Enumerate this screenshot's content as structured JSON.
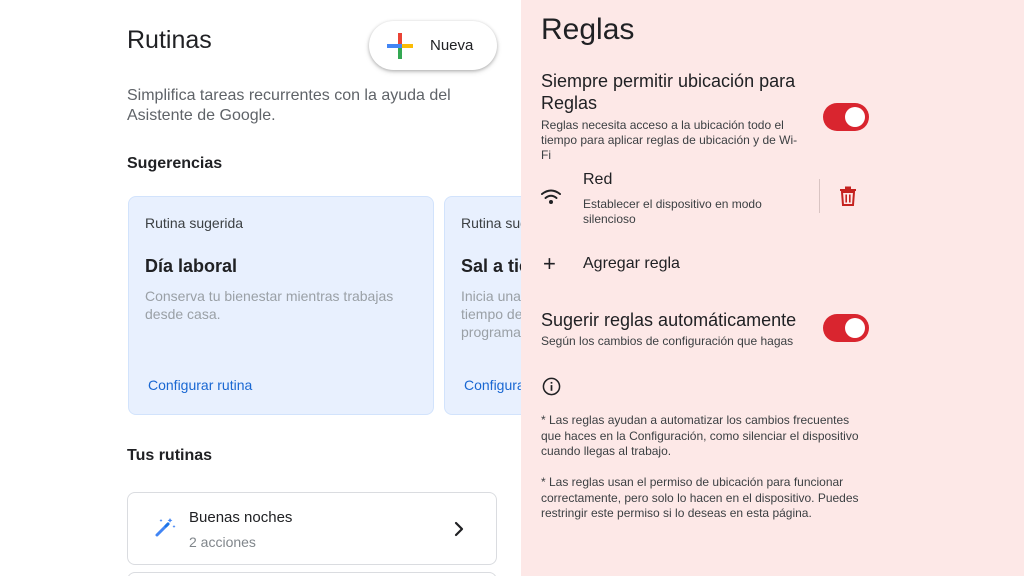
{
  "left": {
    "title": "Rutinas",
    "new_button": "Nueva",
    "description": "Simplifica tareas recurrentes con la ayuda del Asistente de Google.",
    "suggestions_heading": "Sugerencias",
    "cards": [
      {
        "kicker": "Rutina sugerida",
        "title": "Día laboral",
        "description": "Conserva tu bienestar mientras trabajas desde casa.",
        "link": "Configurar rutina"
      },
      {
        "kicker": "Rutina sugerida",
        "title": "Sal a tiempo",
        "description": "Inicia una rutina antes de salir a tiempo de casa con alertas programadas.",
        "link": "Configurar rutina"
      }
    ],
    "your_routines_heading": "Tus rutinas",
    "routines": [
      {
        "name": "Buenas noches",
        "sub": "2 acciones",
        "icon": "magic-wand-icon"
      }
    ],
    "colors": {
      "card_bg": "#e8f0fe",
      "link": "#1967d2"
    }
  },
  "right": {
    "title": "Reglas",
    "location": {
      "title": "Siempre permitir ubicación para Reglas",
      "description": "Reglas necesita acceso a la ubicación todo el tiempo para aplicar reglas de ubicación y de Wi-Fi",
      "enabled": true
    },
    "rule": {
      "icon": "wifi-icon",
      "name": "Red",
      "description": "Establecer el dispositivo en modo silencioso",
      "delete_icon": "trash-icon"
    },
    "add_rule": {
      "icon": "plus-icon",
      "label": "Agregar regla"
    },
    "auto_suggest": {
      "title": "Sugerir reglas automáticamente",
      "description": "Según los cambios de configuración que hagas",
      "enabled": true
    },
    "info_icon": "info-icon",
    "notes": [
      "* Las reglas ayudan a automatizar los cambios frecuentes que haces en la Configuración, como silenciar el dispositivo cuando llegas al trabajo.",
      "* Las reglas usan el permiso de ubicación para funcionar correctamente, pero solo lo hacen en el dispositivo. Puedes restringir este permiso si lo deseas en esta página."
    ],
    "colors": {
      "background": "#fde8e7",
      "toggle_on": "#d9252f",
      "trash": "#c5221f"
    }
  }
}
